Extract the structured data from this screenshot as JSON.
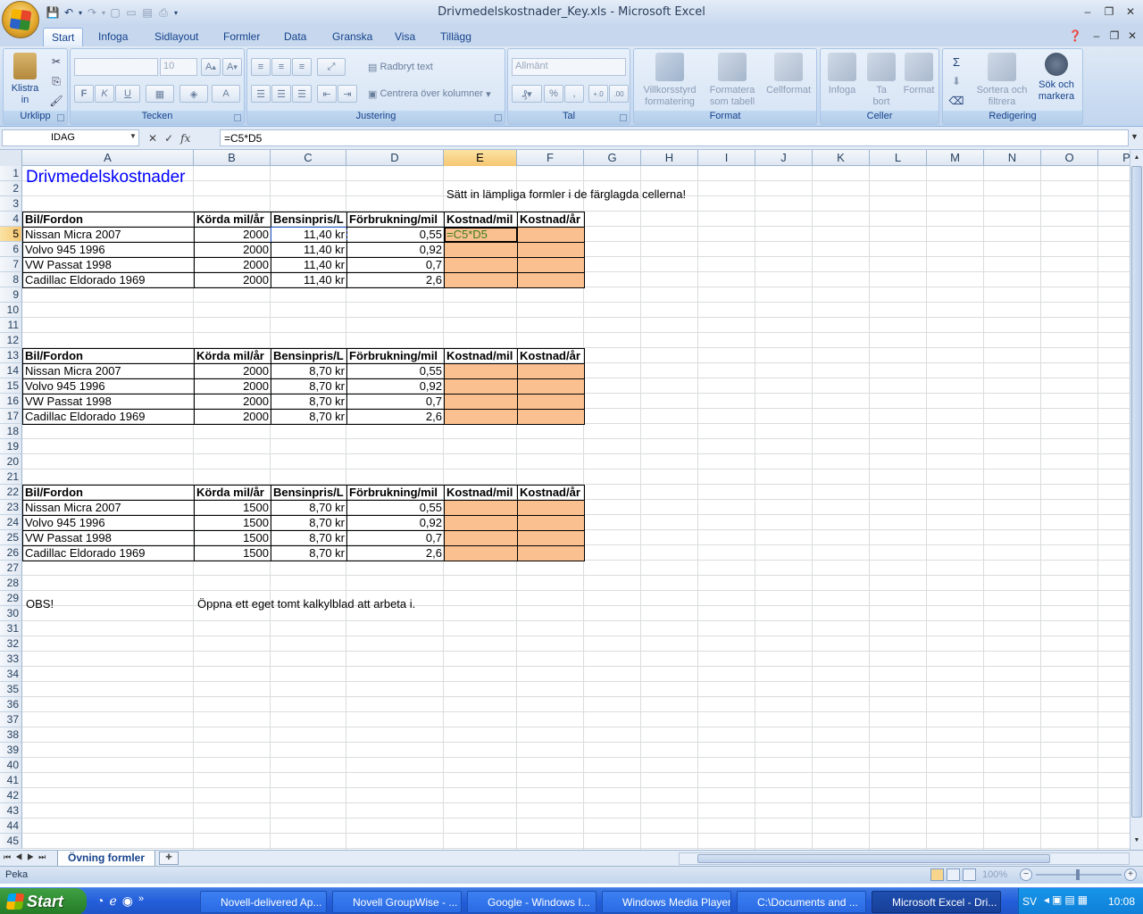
{
  "window": {
    "title": "Drivmedelskostnader_Key.xls - Microsoft Excel"
  },
  "tabs": [
    "Start",
    "Infoga",
    "Sidlayout",
    "Formler",
    "Data",
    "Granska",
    "Visa",
    "Tillägg"
  ],
  "ribbon": {
    "clipboard": {
      "paste_label": "Klistra",
      "paste_label2": "in",
      "group": "Urklipp"
    },
    "font": {
      "font_name": "",
      "font_size": "10",
      "group": "Tecken",
      "bold": "F",
      "italic": "K",
      "underline": "U"
    },
    "alignment": {
      "wrap": "Radbryt text",
      "merge": "Centrera över kolumner",
      "group": "Justering"
    },
    "number": {
      "format": "Allmänt",
      "group": "Tal"
    },
    "styles": {
      "cond": "Villkorsstyrd",
      "cond2": "formatering",
      "table": "Formatera",
      "table2": "som tabell",
      "cell": "Cellformat",
      "group": "Format"
    },
    "cells": {
      "insert": "Infoga",
      "delete": "Ta",
      "delete2": "bort",
      "format": "Format",
      "group": "Celler"
    },
    "editing": {
      "sort": "Sortera och",
      "sort2": "filtrera",
      "find": "Sök och",
      "find2": "markera",
      "group": "Redigering"
    }
  },
  "formula_bar": {
    "name_box": "IDAG",
    "formula": "=C5*D5"
  },
  "columns": [
    "A",
    "B",
    "C",
    "D",
    "E",
    "F",
    "G",
    "H",
    "I",
    "J",
    "K",
    "L",
    "M",
    "N",
    "O",
    "P"
  ],
  "rows": [
    "1",
    "2",
    "3",
    "4",
    "5",
    "6",
    "7",
    "8",
    "9",
    "10",
    "11",
    "12",
    "13",
    "14",
    "15",
    "16",
    "17",
    "18",
    "19",
    "20",
    "21",
    "22",
    "23",
    "24",
    "25",
    "26",
    "27",
    "28",
    "29",
    "30",
    "31",
    "32",
    "33",
    "34",
    "35",
    "36",
    "37",
    "38",
    "39",
    "40",
    "41",
    "42",
    "43",
    "44",
    "45"
  ],
  "sheet": {
    "title": "Drivmedelskostnader",
    "instruction": "Sätt in lämpliga formler i de färglagda cellerna!",
    "headers": [
      "Bil/Fordon",
      "Körda mil/år",
      "Bensinpris/L",
      "Förbrukning/mil",
      "Kostnad/mil",
      "Kostnad/år"
    ],
    "tables": [
      {
        "rows": [
          {
            "car": "Nissan Micra  2007",
            "km": "2000",
            "price": "11,40 kr",
            "cons": "0,55",
            "cost_mil": "=C5*D5"
          },
          {
            "car": "Volvo 945  1996",
            "km": "2000",
            "price": "11,40 kr",
            "cons": "0,92",
            "cost_mil": ""
          },
          {
            "car": "VW Passat  1998",
            "km": "2000",
            "price": "11,40 kr",
            "cons": "0,7",
            "cost_mil": ""
          },
          {
            "car": "Cadillac  Eldorado 1969",
            "km": "2000",
            "price": "11,40 kr",
            "cons": "2,6",
            "cost_mil": ""
          }
        ]
      },
      {
        "rows": [
          {
            "car": "Nissan Micra  2007",
            "km": "2000",
            "price": "8,70 kr",
            "cons": "0,55",
            "cost_mil": ""
          },
          {
            "car": "Volvo 945  1996",
            "km": "2000",
            "price": "8,70 kr",
            "cons": "0,92",
            "cost_mil": ""
          },
          {
            "car": "VW Passat  1998",
            "km": "2000",
            "price": "8,70 kr",
            "cons": "0,7",
            "cost_mil": ""
          },
          {
            "car": "Cadillac  Eldorado 1969",
            "km": "2000",
            "price": "8,70 kr",
            "cons": "2,6",
            "cost_mil": ""
          }
        ]
      },
      {
        "rows": [
          {
            "car": "Nissan Micra  2007",
            "km": "1500",
            "price": "8,70 kr",
            "cons": "0,55",
            "cost_mil": ""
          },
          {
            "car": "Volvo 945  1996",
            "km": "1500",
            "price": "8,70 kr",
            "cons": "0,92",
            "cost_mil": ""
          },
          {
            "car": "VW Passat  1998",
            "km": "1500",
            "price": "8,70 kr",
            "cons": "0,7",
            "cost_mil": ""
          },
          {
            "car": "Cadillac  Eldorado 1969",
            "km": "1500",
            "price": "8,70 kr",
            "cons": "2,6",
            "cost_mil": ""
          }
        ]
      }
    ],
    "note_label": "OBS!",
    "note_text": "Öppna ett eget tomt kalkylblad att arbeta i."
  },
  "sheet_tab": "Övning formler",
  "status": {
    "mode": "Peka",
    "zoom": "100%"
  },
  "taskbar": {
    "start": "Start",
    "tasks": [
      "Novell-delivered Ap...",
      "Novell GroupWise - ...",
      "Google - Windows I...",
      "Windows Media Player",
      "C:\\Documents and ...",
      "Microsoft Excel - Dri..."
    ],
    "lang": "SV",
    "clock": "10:08"
  },
  "colors": {
    "fill": "#fac090",
    "title_blue": "#0000ff",
    "select_blue": "#0000cc"
  }
}
